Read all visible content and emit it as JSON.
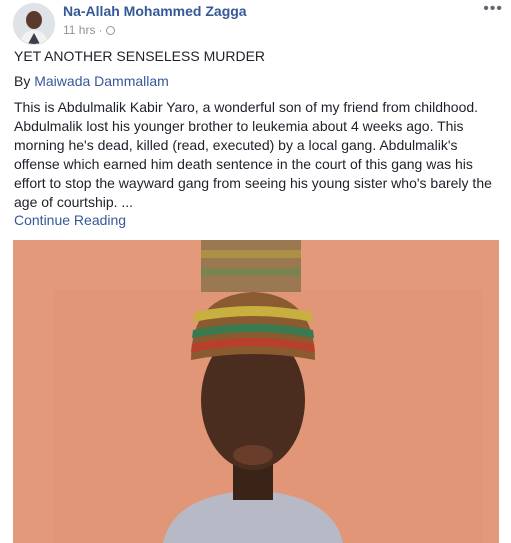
{
  "post": {
    "author": "Na-Allah Mohammed Zagga",
    "time": "11 hrs",
    "separator": "·",
    "more_label": "•••",
    "title": "YET ANOTHER SENSELESS MURDER",
    "byline_prefix": "By ",
    "byline_author": "Maiwada Dammallam",
    "body": "This is Abdulmalik Kabir Yaro, a wonderful son of my friend from childhood. Abdulmalik lost his younger brother to leukemia about 4 weeks ago. This morning he's dead, killed (read, executed) by a local gang. Abdulmalik's offense which earned him death sentence in the court of this gang was his effort to stop the wayward gang from seeing his young sister who's barely the age of courtship. ...",
    "continue_label": "Continue Reading"
  },
  "colors": {
    "link": "#365899",
    "text": "#1d2129",
    "meta": "#90949c"
  },
  "icons": {
    "privacy": "globe-icon",
    "menu": "more-options-icon"
  }
}
